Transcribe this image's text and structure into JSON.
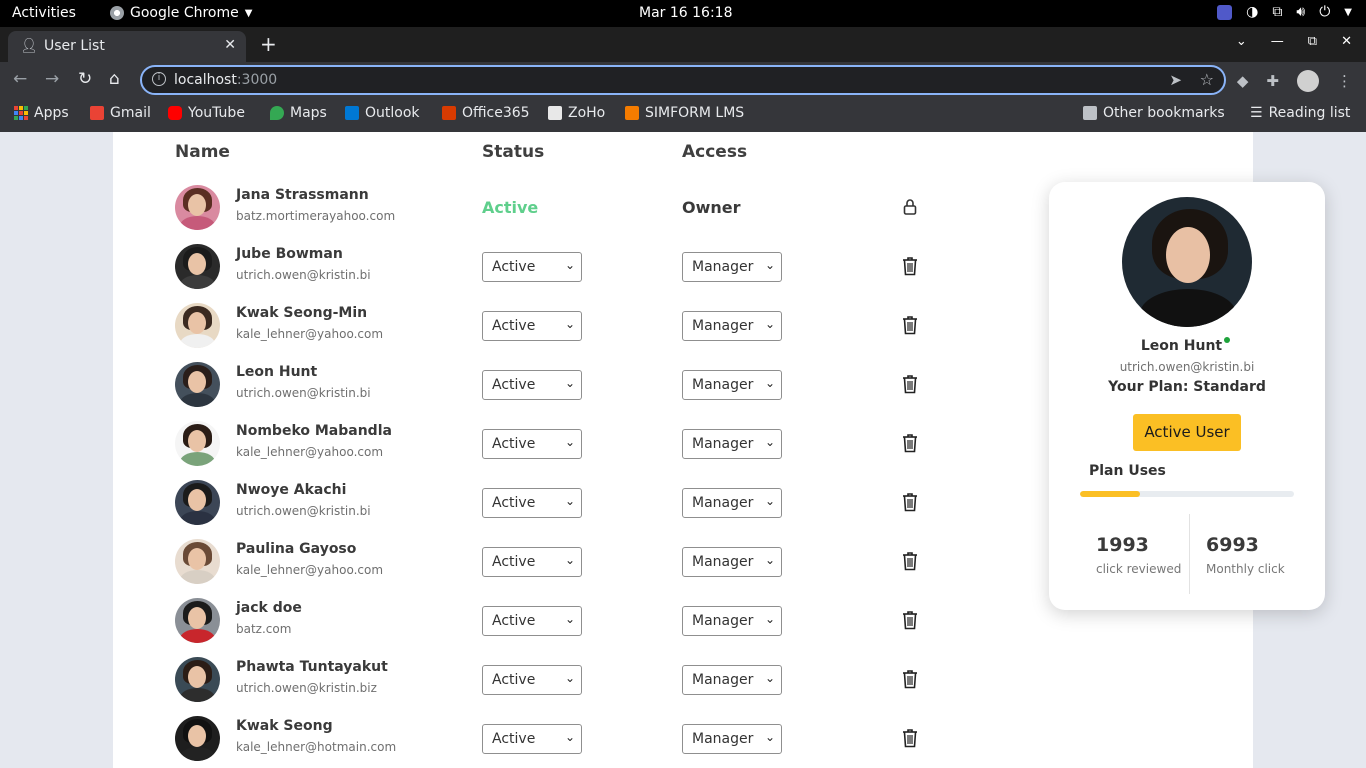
{
  "system_bar": {
    "activities": "Activities",
    "app_name": "Google Chrome",
    "datetime": "Mar 16  16:18"
  },
  "browser": {
    "tab_title": "User List",
    "new_tab": "+",
    "url_host": "localhost",
    "url_port": ":3000",
    "bookmarks": [
      {
        "label": "Apps",
        "icon": "apps-grid-icon"
      },
      {
        "label": "Gmail",
        "icon": "gmail-icon",
        "color": "#ea4335"
      },
      {
        "label": "YouTube",
        "icon": "youtube-icon",
        "color": "#ff0000"
      },
      {
        "label": "Maps",
        "icon": "maps-icon",
        "color": "#34a853"
      },
      {
        "label": "Outlook",
        "icon": "outlook-icon",
        "color": "#0078d4"
      },
      {
        "label": "Office365",
        "icon": "office-icon",
        "color": "#d83b01"
      },
      {
        "label": "ZoHo",
        "icon": "zoho-icon",
        "color": "#e8e8e8"
      },
      {
        "label": "SIMFORM LMS",
        "icon": "simform-icon",
        "color": "#f57c00"
      }
    ],
    "other_bookmarks": "Other bookmarks",
    "reading_list": "Reading list"
  },
  "table": {
    "headers": {
      "name": "Name",
      "status": "Status",
      "access": "Access"
    },
    "owner_row": {
      "name": "Jana Strassmann",
      "email": "batz.mortimerayahoo.com",
      "status": "Active",
      "access": "Owner",
      "icon": "lock-icon"
    },
    "rows": [
      {
        "name": "Jube Bowman",
        "email": "utrich.owen@kristin.bi",
        "status": "Active",
        "access": "Manager"
      },
      {
        "name": "Kwak Seong-Min",
        "email": "kale_lehner@yahoo.com",
        "status": "Active",
        "access": "Manager"
      },
      {
        "name": "Leon Hunt",
        "email": "utrich.owen@kristin.bi",
        "status": "Active",
        "access": "Manager"
      },
      {
        "name": "Nombeko Mabandla",
        "email": "kale_lehner@yahoo.com",
        "status": "Active",
        "access": "Manager"
      },
      {
        "name": "Nwoye Akachi",
        "email": "utrich.owen@kristin.bi",
        "status": "Active",
        "access": "Manager"
      },
      {
        "name": "Paulina Gayoso",
        "email": "kale_lehner@yahoo.com",
        "status": "Active",
        "access": "Manager"
      },
      {
        "name": "jack doe",
        "email": "batz.com",
        "status": "Active",
        "access": "Manager"
      },
      {
        "name": "Phawta Tuntayakut",
        "email": "utrich.owen@kristin.biz",
        "status": "Active",
        "access": "Manager"
      },
      {
        "name": "Kwak Seong",
        "email": "kale_lehner@hotmain.com",
        "status": "Active",
        "access": "Manager"
      }
    ]
  },
  "profile_card": {
    "name": "Leon Hunt",
    "email": "utrich.owen@kristin.bi",
    "plan": "Your Plan: Standard",
    "button": "Active User",
    "uses_label": "Plan Uses",
    "uses_progress": 0.28,
    "stats": [
      {
        "value": "1993",
        "label": "click reviewed"
      },
      {
        "value": "6993",
        "label": "Monthly click"
      }
    ]
  },
  "colors": {
    "active_green": "#5fcf8c",
    "accent_yellow": "#fbbf24",
    "online_dot": "#1fa33b"
  }
}
